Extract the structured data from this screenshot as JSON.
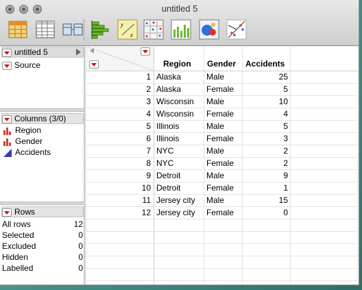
{
  "window": {
    "title": "untitled 5"
  },
  "toolbar": {
    "icons": [
      "data-table-icon",
      "column-viewer-icon",
      "tables-join-icon",
      "distribution-icon",
      "fit-y-by-x-icon",
      "scatterplot-matrix-icon",
      "graph-builder-icon",
      "multivariate-icon",
      "bivariate-plot-icon"
    ]
  },
  "table_panel": {
    "name": "untitled 5",
    "source": "Source"
  },
  "columns_panel": {
    "header": "Columns (3/0)",
    "columns": [
      {
        "name": "Region",
        "type_icon": "nominal-icon"
      },
      {
        "name": "Gender",
        "type_icon": "nominal-icon"
      },
      {
        "name": "Accidents",
        "type_icon": "continuous-icon"
      }
    ]
  },
  "rows_panel": {
    "header": "Rows",
    "stats": [
      {
        "label": "All rows",
        "value": "12"
      },
      {
        "label": "Selected",
        "value": "0"
      },
      {
        "label": "Excluded",
        "value": "0"
      },
      {
        "label": "Hidden",
        "value": "0"
      },
      {
        "label": "Labelled",
        "value": "0"
      }
    ]
  },
  "table": {
    "headers": [
      "Region",
      "Gender",
      "Accidents"
    ],
    "rows": [
      {
        "n": "1",
        "region": "Alaska",
        "gender": "Male",
        "accidents": "25"
      },
      {
        "n": "2",
        "region": "Alaska",
        "gender": "Female",
        "accidents": "5"
      },
      {
        "n": "3",
        "region": "Wisconsin",
        "gender": "Male",
        "accidents": "10"
      },
      {
        "n": "4",
        "region": "Wisconsin",
        "gender": "Female",
        "accidents": "4"
      },
      {
        "n": "5",
        "region": "Illinois",
        "gender": "Male",
        "accidents": "5"
      },
      {
        "n": "6",
        "region": "Illinois",
        "gender": "Female",
        "accidents": "3"
      },
      {
        "n": "7",
        "region": "NYC",
        "gender": "Male",
        "accidents": "2"
      },
      {
        "n": "8",
        "region": "NYC",
        "gender": "Female",
        "accidents": "2"
      },
      {
        "n": "9",
        "region": "Detroit",
        "gender": "Male",
        "accidents": "9"
      },
      {
        "n": "10",
        "region": "Detroit",
        "gender": "Female",
        "accidents": "1"
      },
      {
        "n": "11",
        "region": "Jersey city",
        "gender": "Male",
        "accidents": "15"
      },
      {
        "n": "12",
        "region": "Jersey city",
        "gender": "Female",
        "accidents": "0"
      }
    ]
  },
  "colors": {
    "accent_red": "#d0101c",
    "continuous_blue": "#3a3ab0"
  }
}
